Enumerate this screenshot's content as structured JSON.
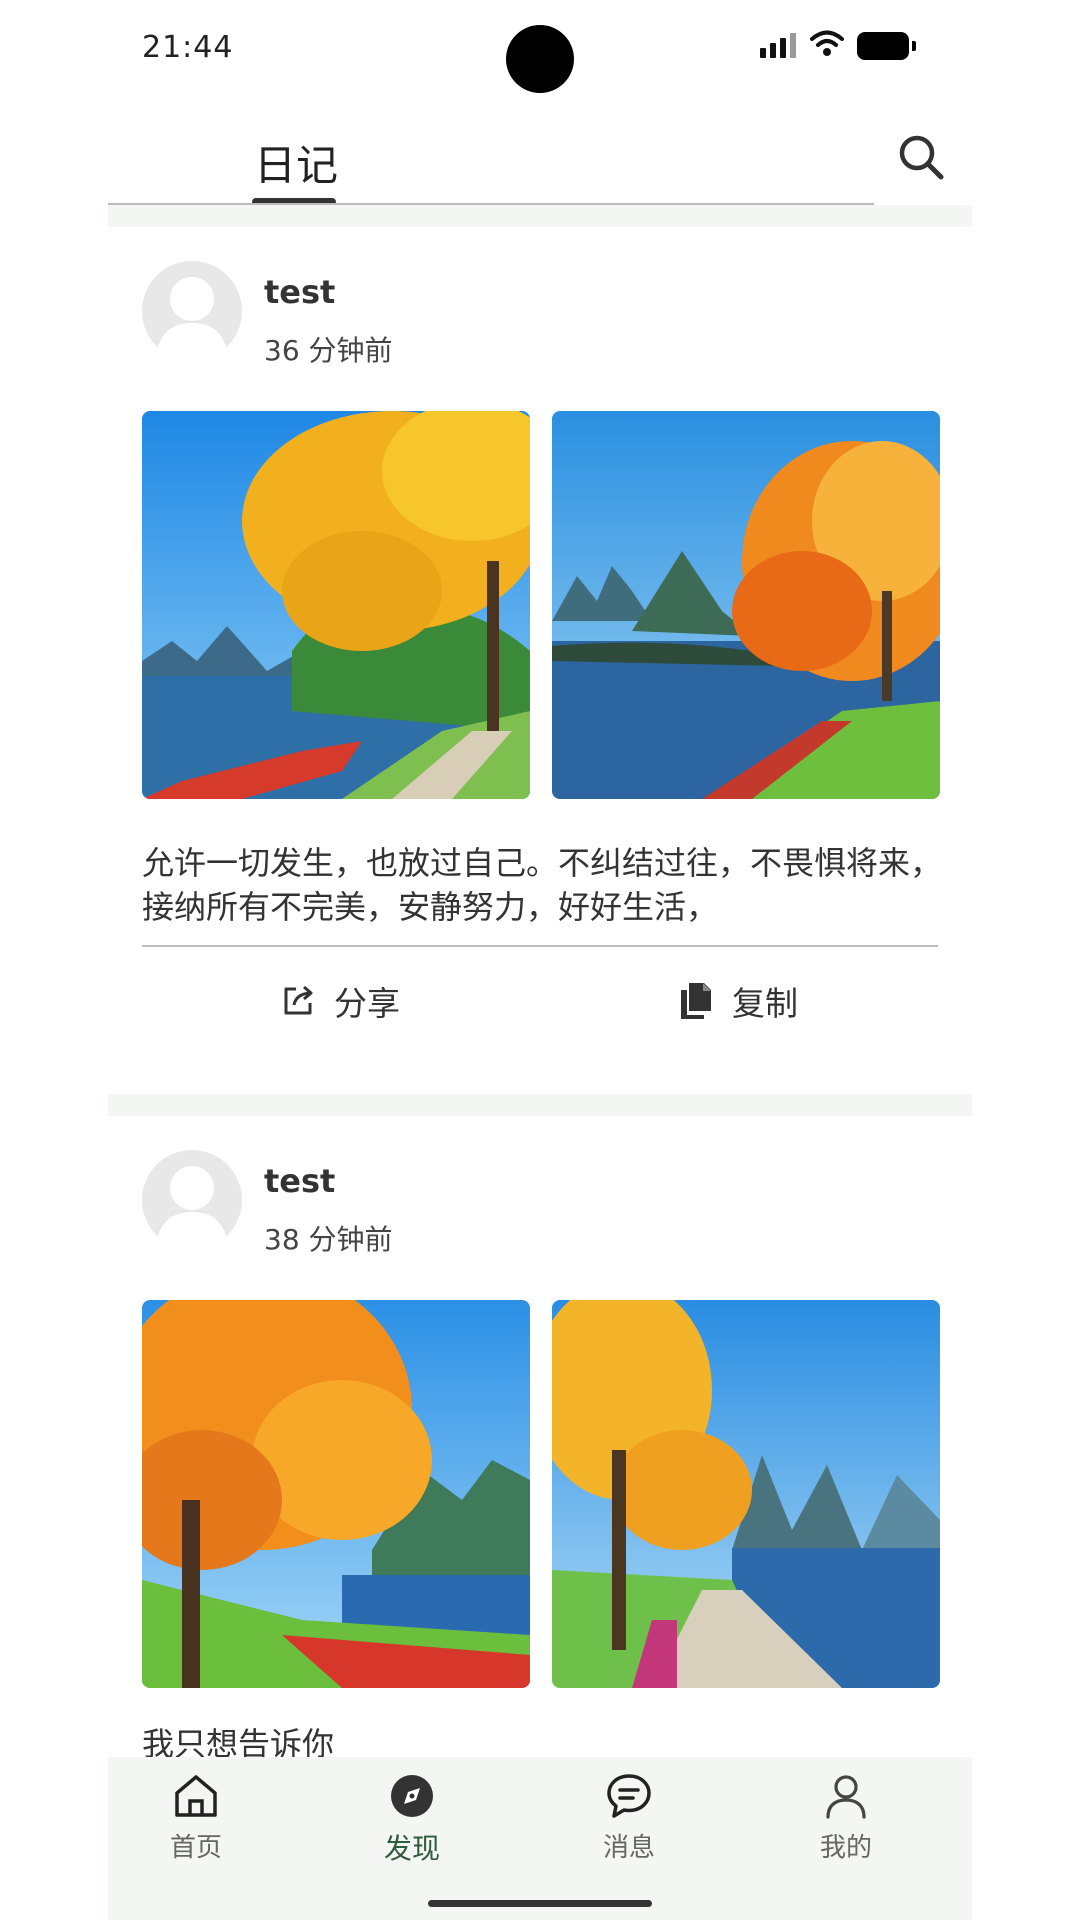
{
  "status": {
    "time": "21:44"
  },
  "header": {
    "tab_title": "日记"
  },
  "posts": [
    {
      "user": "test",
      "time": "36 分钟前",
      "content": "允许一切发生，也放过自己。不纠结过往，不畏惧将来，接纳所有不完美，安静努力，好好生活，",
      "share_label": "分享",
      "copy_label": "复制"
    },
    {
      "user": "test",
      "time": "38 分钟前",
      "content": "我只想告诉你"
    }
  ],
  "nav": {
    "items": [
      {
        "label": "首页"
      },
      {
        "label": "发现"
      },
      {
        "label": "消息"
      },
      {
        "label": "我的"
      }
    ],
    "active_color": "#2e5c3e"
  }
}
